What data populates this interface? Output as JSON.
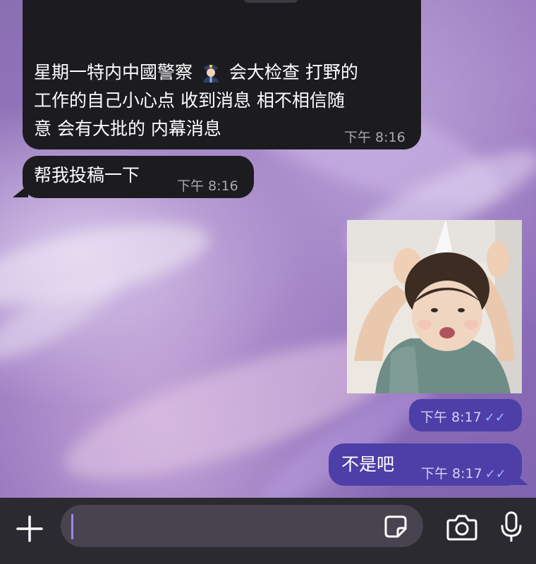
{
  "messages": [
    {
      "id": "m1",
      "direction": "incoming",
      "text_lines": [
        "星期一特内中國警察",
        "工作的自己小心点 收到消息 相不相信随",
        "意 会有大批的 内幕消息"
      ],
      "line1_tail": "会大检查 打野的",
      "emoji": "police-officer-icon",
      "time": "下午 8:16"
    },
    {
      "id": "m2",
      "direction": "incoming",
      "text": "帮我投稿一下",
      "time": "下午 8:16"
    },
    {
      "id": "m3",
      "direction": "outgoing",
      "type": "image",
      "image": "baby-photo",
      "time": "下午 8:17",
      "status": "read"
    },
    {
      "id": "m4",
      "direction": "outgoing",
      "text": "不是吧",
      "time": "下午 8:17",
      "status": "read"
    }
  ],
  "composer": {
    "placeholder": "",
    "icons": [
      "plus-icon",
      "sticker-icon",
      "camera-icon",
      "microphone-icon"
    ]
  },
  "colors": {
    "incoming_bubble": "#1c1b1f",
    "outgoing_bubble": "#4d3ea8",
    "read_ticks": "#9fb6ff",
    "composer_bar": "#2b2a30",
    "input_field": "#48444f"
  }
}
